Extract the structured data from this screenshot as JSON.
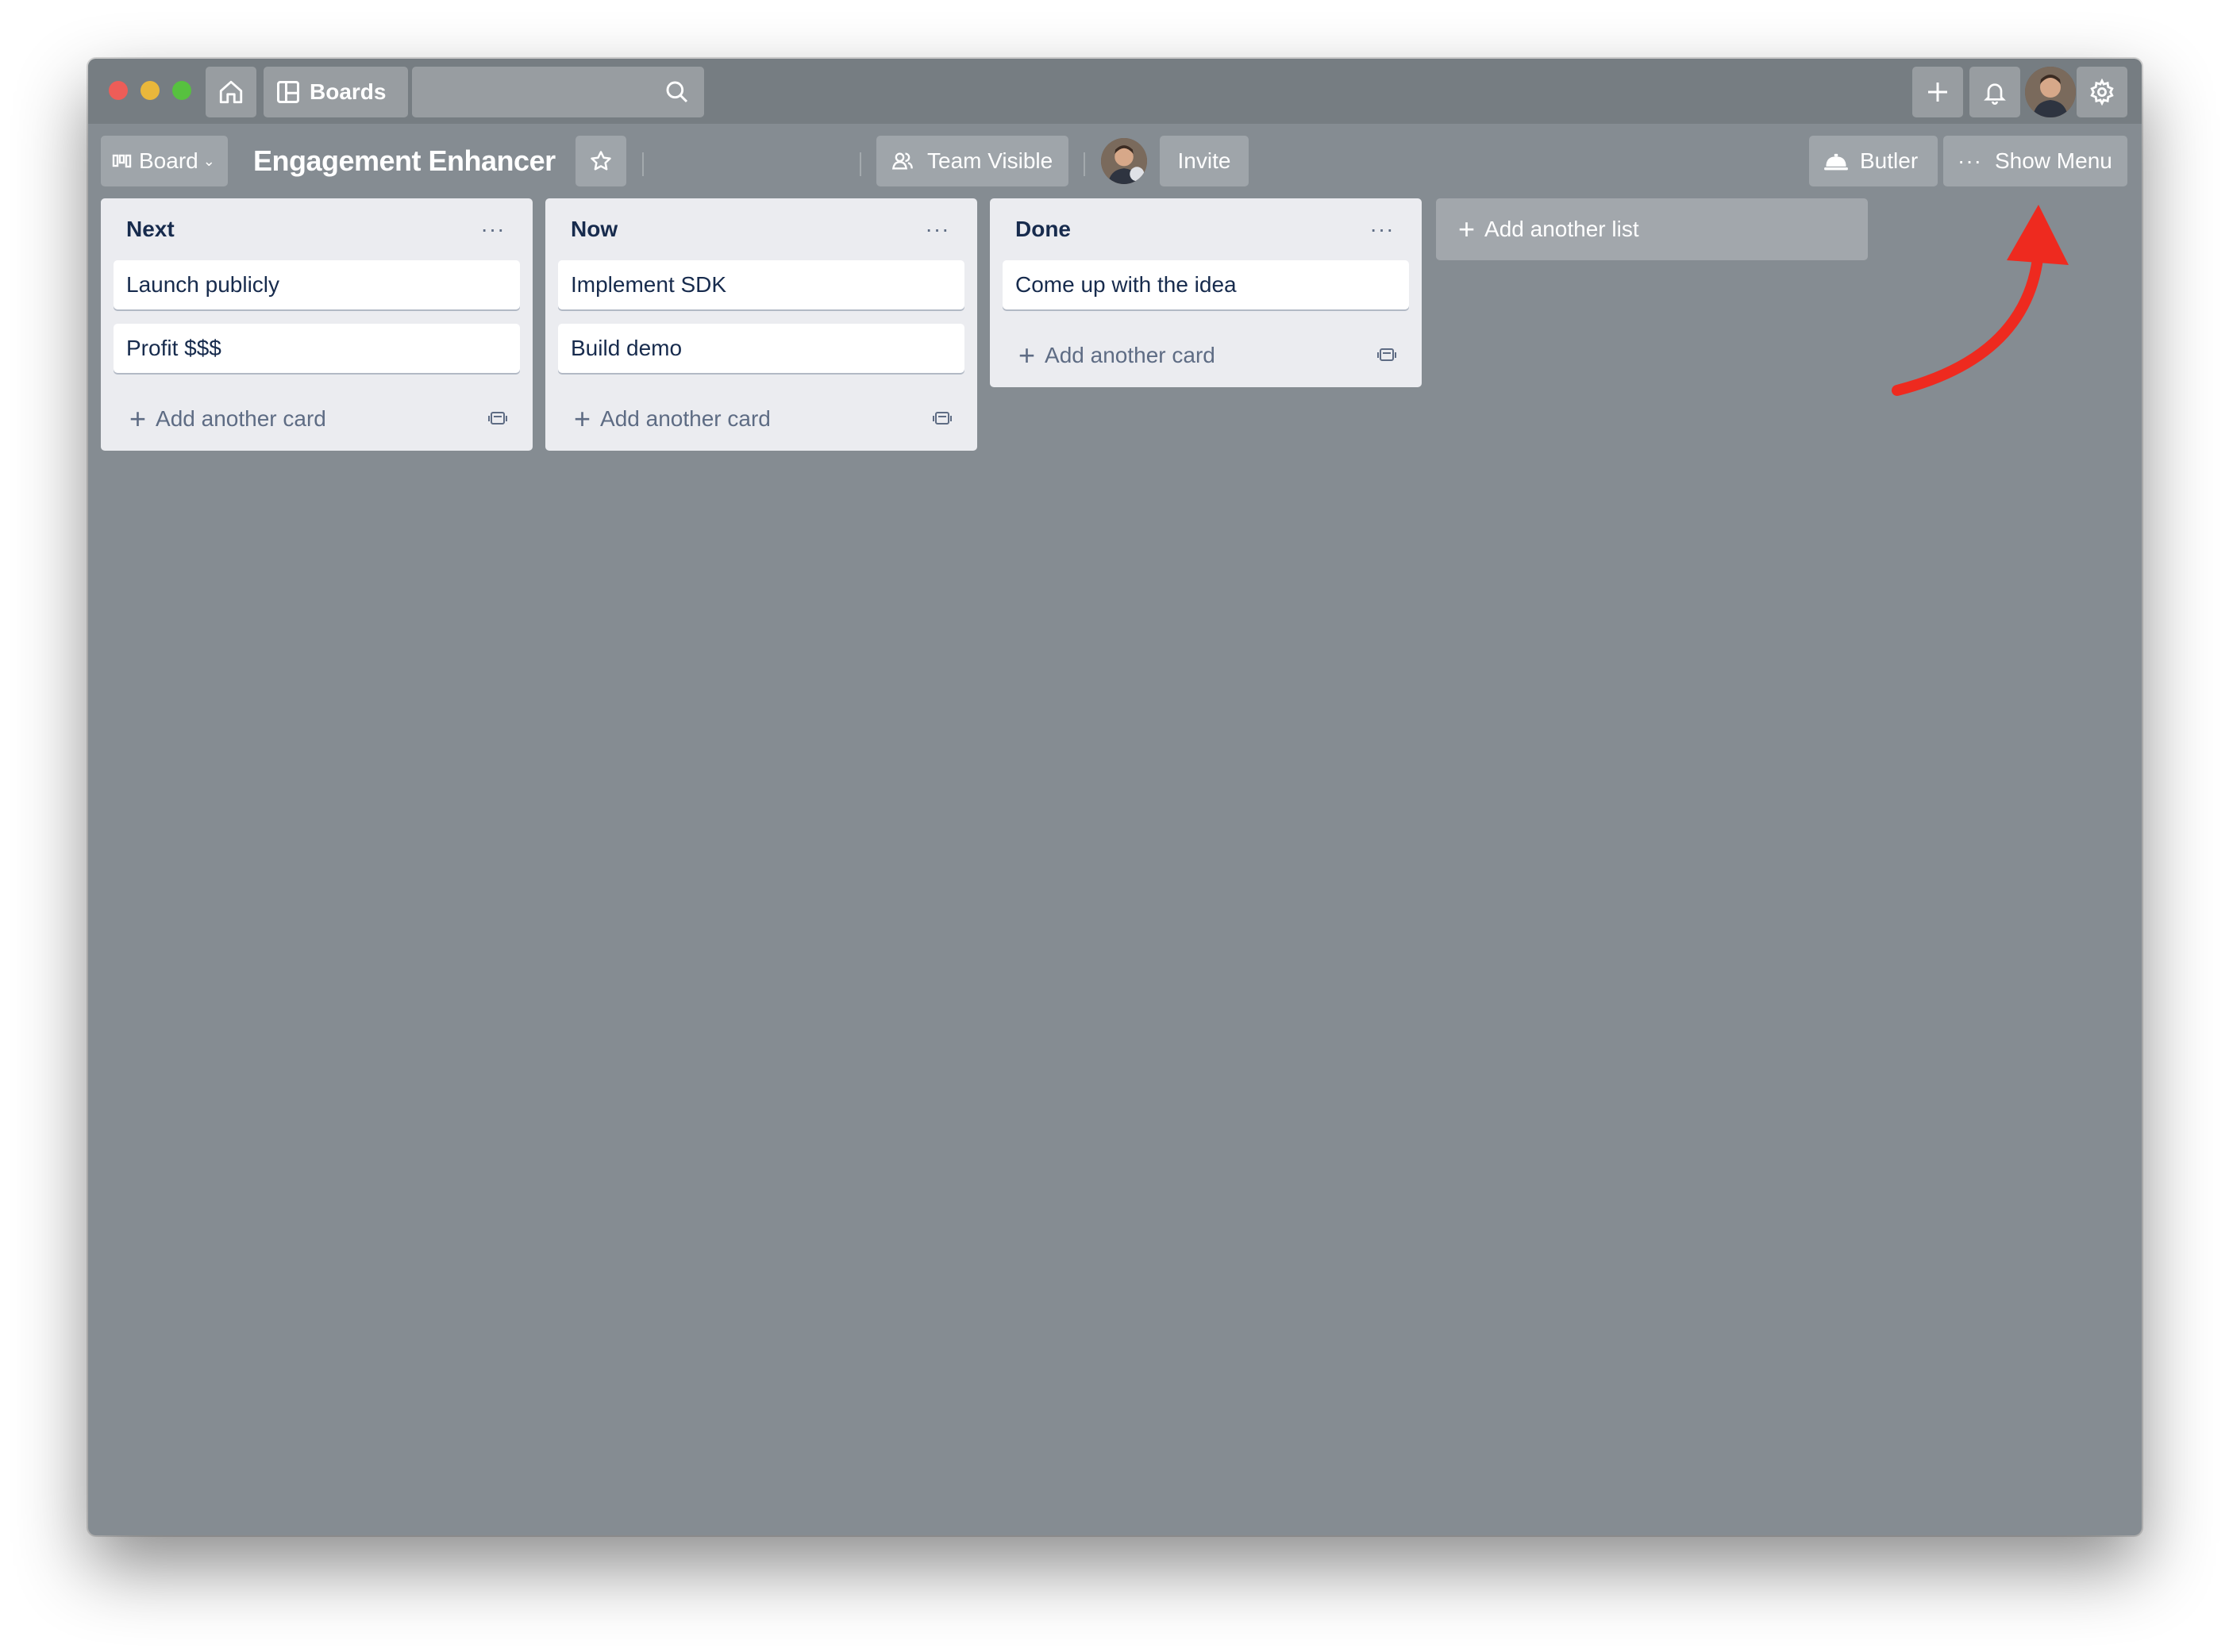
{
  "topbar": {
    "boards_label": "Boards",
    "search_value": "",
    "icons": [
      "home-icon",
      "boards-icon",
      "search-icon",
      "plus-icon",
      "bell-icon",
      "avatar",
      "gear-icon"
    ]
  },
  "boardbar": {
    "board_switcher_label": "Board",
    "board_title": "Engagement Enhancer",
    "visibility_label": "Team Visible",
    "invite_label": "Invite",
    "butler_label": "Butler",
    "show_menu_label": "Show Menu"
  },
  "lists": [
    {
      "title": "Next",
      "cards": [
        "Launch publicly",
        "Profit $$$"
      ],
      "add_card_label": "Add another card"
    },
    {
      "title": "Now",
      "cards": [
        "Implement SDK",
        "Build demo"
      ],
      "add_card_label": "Add another card"
    },
    {
      "title": "Done",
      "cards": [
        "Come up with the idea"
      ],
      "add_card_label": "Add another card"
    }
  ],
  "add_list_label": "Add another list",
  "colors": {
    "board_background": "#858c92",
    "topbar": "#767d82",
    "list_background": "#ebecf0",
    "annotation_arrow": "#ee2a1f"
  }
}
